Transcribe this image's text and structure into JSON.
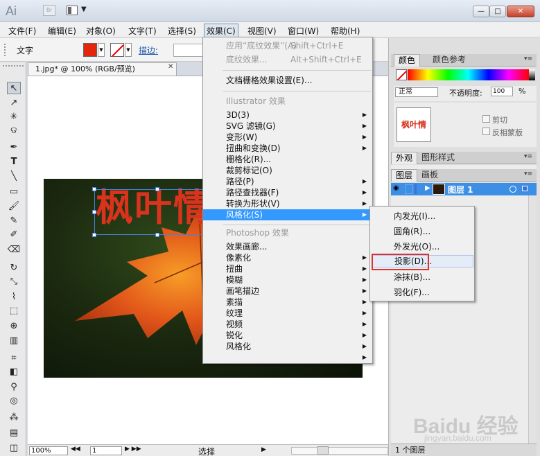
{
  "titlebar": {
    "logo": "Ai",
    "bridge": "Br",
    "min": "—",
    "max": "□",
    "close": "✕"
  },
  "menubar": {
    "items": [
      "文件(F)",
      "编辑(E)",
      "对象(O)",
      "文字(T)",
      "选择(S)",
      "效果(C)",
      "视图(V)",
      "窗口(W)",
      "帮助(H)"
    ]
  },
  "controlbar": {
    "tool_label": "文字",
    "fill_color": "#e3250b",
    "stroke_label": "描边:"
  },
  "document": {
    "tab_title": "1.jpg* @ 100% (RGB/预览)",
    "close": "✕",
    "art_text": "枫叶情"
  },
  "statusbar": {
    "zoom": "100%",
    "page": "1",
    "status": "选择"
  },
  "effect_menu": {
    "apply_last": {
      "label": "应用“底纹效果”(A)",
      "shortcut": "Shift+Ctrl+E"
    },
    "last_effect": {
      "label": "底纹效果...",
      "shortcut": "Alt+Shift+Ctrl+E"
    },
    "raster_settings": "文档栅格效果设置(E)...",
    "illustrator_header": "Illustrator 效果",
    "illustrator_items": [
      "3D(3)",
      "SVG 滤镜(G)",
      "变形(W)",
      "扭曲和变换(D)",
      "栅格化(R)...",
      "裁剪标记(O)",
      "路径(P)",
      "路径查找器(F)",
      "转换为形状(V)",
      "风格化(S)"
    ],
    "photoshop_header": "Photoshop 效果",
    "photoshop_items": [
      "效果画廊...",
      "像素化",
      "扭曲",
      "模糊",
      "画笔描边",
      "素描",
      "纹理",
      "视频",
      "锐化",
      "风格化"
    ]
  },
  "stylize_submenu": {
    "items": [
      "内发光(I)...",
      "圆角(R)...",
      "外发光(O)...",
      "投影(D)...",
      "涂抹(B)...",
      "羽化(F)..."
    ]
  },
  "panels": {
    "color_tabs": [
      "颜色",
      "颜色参考"
    ],
    "blend_mode": "正常",
    "opacity_label": "不透明度:",
    "opacity_value": "100",
    "percent": "%",
    "thumb_text": "枫叶情",
    "clip_label": "剪切",
    "invert_label": "反相蒙版",
    "appearance_tabs": [
      "外观",
      "图形样式"
    ],
    "layers_tabs": [
      "图层",
      "画板"
    ],
    "layer_name": "图层 1",
    "layer_count": "1 个图层"
  },
  "watermark": {
    "logo": "Baidu 经验",
    "url": "jingyan.baidu.com"
  },
  "colors": {
    "highlight": "#3399ff",
    "accent_red": "#e03030",
    "layer_row": "#3d8fe5"
  }
}
